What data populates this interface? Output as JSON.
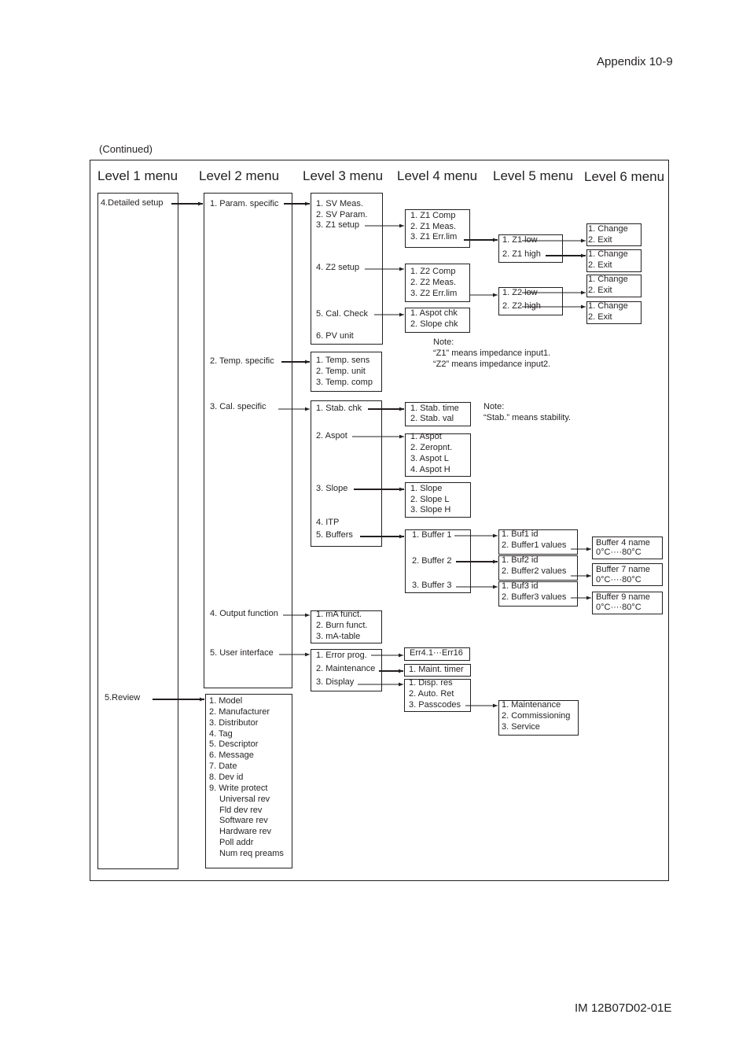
{
  "page": {
    "header_right": "Appendix 10-9",
    "continued": "(Continued)",
    "footer_right": "IM 12B07D02-01E"
  },
  "levels": [
    "Level 1 menu",
    "Level 2 menu",
    "Level 3 menu",
    "Level 4 menu",
    "Level 5 menu",
    "Level 6 menu"
  ],
  "level1": {
    "detailed_setup": "4.Detailed setup",
    "review": "5.Review"
  },
  "level2": {
    "param_specific": "1. Param. specific",
    "temp_specific": "2. Temp. specific",
    "cal_specific": "3. Cal. specific",
    "output_function": "4. Output function",
    "user_interface": "5. User interface",
    "review_items": [
      "1. Model",
      "2. Manufacturer",
      "3. Distributor",
      "4. Tag",
      "5. Descriptor",
      "6. Message",
      "7. Date",
      "8. Dev id",
      "9. Write protect",
      "Universal rev",
      "Fld dev rev",
      "Software rev",
      "Hardware rev",
      "Poll addr",
      "Num req preams"
    ]
  },
  "level3": {
    "param": [
      "1. SV Meas.",
      "2. SV Param.",
      "3. Z1 setup",
      "4. Z2 setup",
      "5. Cal. Check",
      "6. PV unit"
    ],
    "temp": [
      "1. Temp. sens",
      "2. Temp. unit",
      "3. Temp. comp"
    ],
    "cal": [
      "1. Stab. chk",
      "2. Aspot",
      "3. Slope",
      "4. ITP",
      "5. Buffers"
    ],
    "output": [
      "1. mA funct.",
      "2. Burn funct.",
      "3. mA-table"
    ],
    "ui": [
      "1. Error prog.",
      "2. Maintenance",
      "3. Display"
    ]
  },
  "level4": {
    "z1": [
      "1. Z1 Comp",
      "2. Z1 Meas.",
      "3. Z1 Err.lim"
    ],
    "z2": [
      "1. Z2 Comp",
      "2. Z2 Meas.",
      "3. Z2 Err.lim"
    ],
    "calcheck": [
      "1. Aspot chk",
      "2. Slope chk"
    ],
    "stab": [
      "1. Stab. time",
      "2. Stab. val"
    ],
    "aspot": [
      "1. Aspot",
      "2. Zeropnt.",
      "3. Aspot L",
      "4. Aspot H"
    ],
    "slope": [
      "1. Slope",
      "2. Slope L",
      "3. Slope H"
    ],
    "buffers": [
      "1. Buffer 1",
      "2. Buffer 2",
      "3. Buffer 3"
    ],
    "error": "Err4.1···Err16",
    "maint": "1. Maint. timer",
    "display": [
      "1. Disp. res",
      "2. Auto. Ret",
      "3. Passcodes"
    ]
  },
  "level5": {
    "z1": [
      "1. Z1 low",
      "2. Z1 high"
    ],
    "z2": [
      "1. Z2 low",
      "2. Z2 high"
    ],
    "buf1": [
      "1. Buf1 id",
      "2. Buffer1 values"
    ],
    "buf2": [
      "1. Buf2 id",
      "2. Buffer2 values"
    ],
    "buf3": [
      "1. Buf3 id",
      "2. Buffer3 values"
    ],
    "passcodes": [
      "1. Maintenance",
      "2. Commissioning",
      "3. Service"
    ]
  },
  "level6": {
    "change_exit": [
      "1. Change",
      "2. Exit"
    ],
    "buf4": [
      "Buffer 4 name",
      "0°C····80°C"
    ],
    "buf7": [
      "Buffer 7 name",
      "0°C····80°C"
    ],
    "buf9": [
      "Buffer 9 name",
      "0°C····80°C"
    ]
  },
  "notes": {
    "z_title": "Note:",
    "z1": "“Z1” means impedance input1.",
    "z2": "“Z2” means impedance input2.",
    "stab_title": "Note:",
    "stab": "“Stab.” means stability."
  }
}
